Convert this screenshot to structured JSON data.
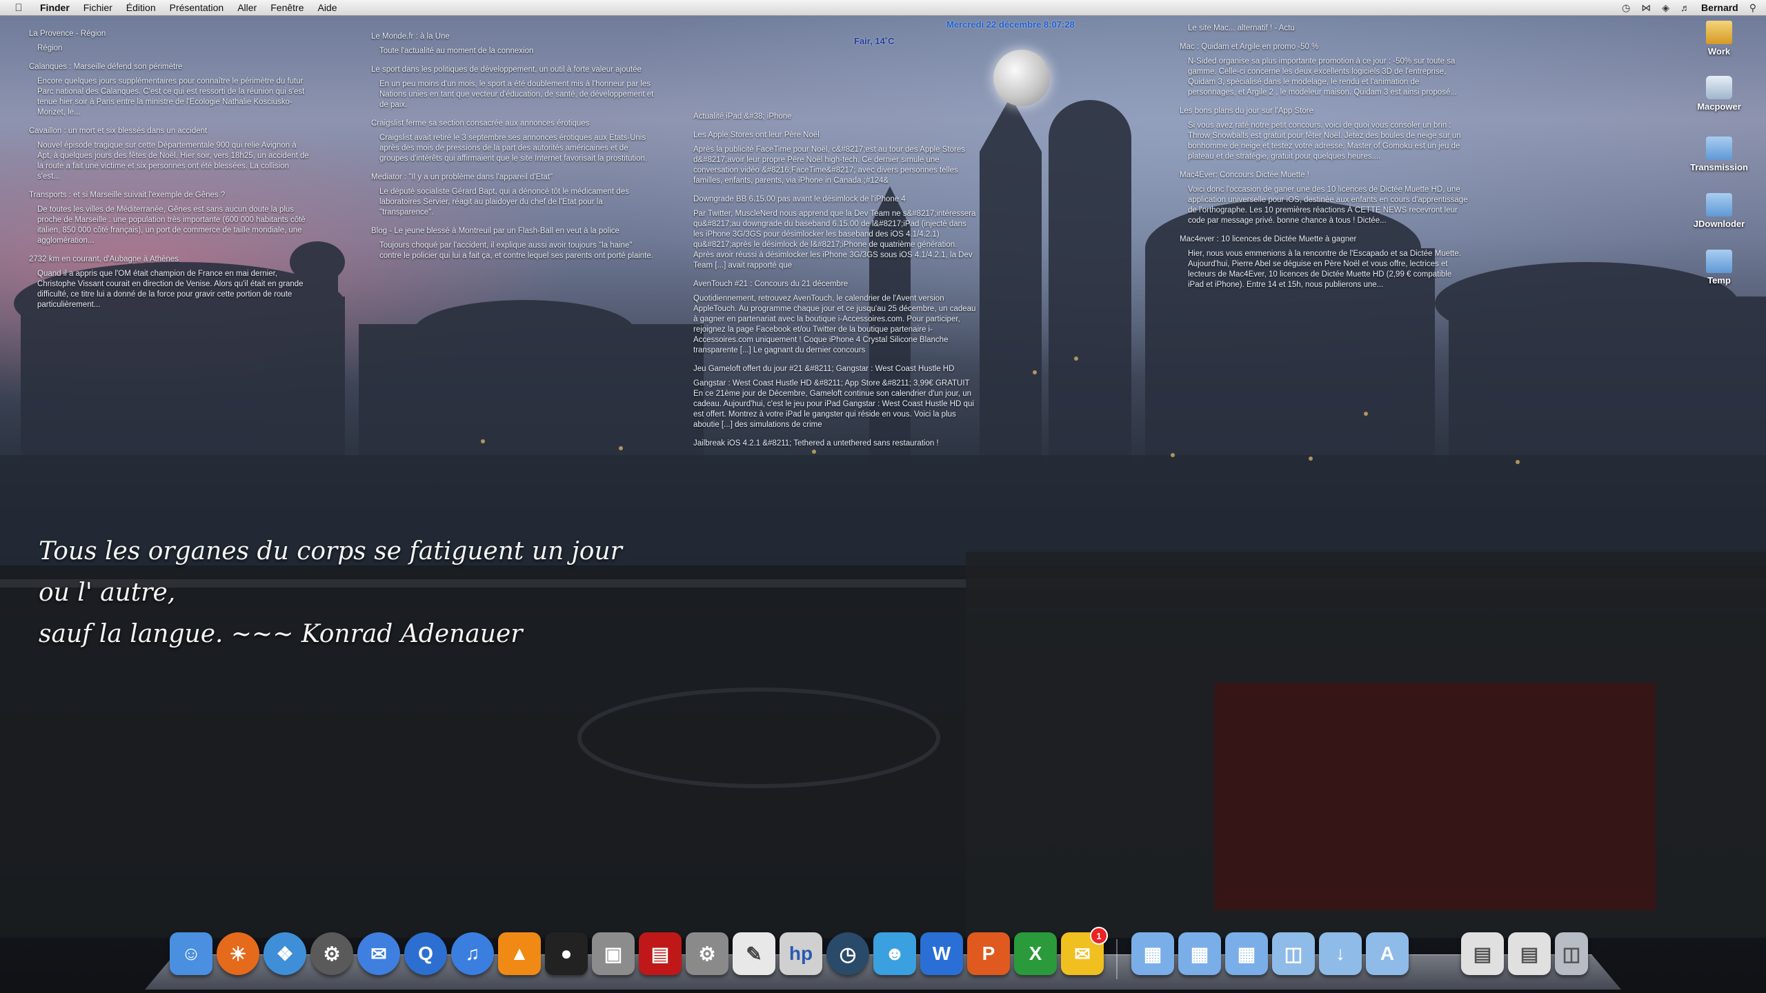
{
  "menubar": {
    "apple_icon": "apple-icon",
    "items": [
      "Finder",
      "Fichier",
      "Édition",
      "Présentation",
      "Aller",
      "Fenêtre",
      "Aide"
    ],
    "user": "Bernard",
    "status_icons": [
      "time-machine-icon",
      "bluetooth-icon",
      "wifi-icon",
      "volume-icon",
      "spotlight-icon"
    ]
  },
  "clock": {
    "text": "Mercredi 22 décembre  8:07:28"
  },
  "weather": {
    "text": "Fair, 14˚C"
  },
  "feed_col1": {
    "items": [
      {
        "title": "La Provence - Région",
        "body": "Région"
      },
      {
        "title": "Calanques : Marseille défend son périmètre",
        "body": "Encore quelques jours supplémentaires pour connaître le périmètre du futur Parc national des Calanques. C'est ce qui est ressorti de la réunion qui s'est tenue hier soir à Paris entre la ministre de l'Ecologie Nathalie Kosciusko-Morizet, le..."
      },
      {
        "title": "Cavaillon : un mort et six blessés dans un accident",
        "body": "Nouvel épisode tragique sur cette Départementale 900 qui relie Avignon à Apt, à quelques jours des fêtes de Noël.  Hier soir, vers 18h25, un accident de la route a fait une victime et six personnes ont été blessées. La collision s'est..."
      },
      {
        "title": "Transports : et si Marseille suivait l'exemple de Gênes ?",
        "body": "De toutes les villes de Méditerranée, Gênes est sans aucun doute la plus proche de Marseille : une population très importante (600 000 habitants côté italien, 850 000 côté français), un port de commerce de taille mondiale, une agglomération..."
      },
      {
        "title": "2732 km en courant, d'Aubagne à Athènes",
        "body": "Quand il a appris que l'OM était champion de France en mai dernier, Christophe Vissant courait en direction de Venise. Alors qu'il était en grande difficulté, ce titre lui a donné de la force pour gravir cette portion de route particulièrement..."
      }
    ]
  },
  "feed_col2": {
    "items": [
      {
        "title": "Le Monde.fr : à la Une",
        "body": "Toute l'actualité au moment de la connexion"
      },
      {
        "title": "Le sport dans les politiques de développement, un outil à forte valeur ajoutée",
        "body": "En un peu moins d'un mois, le sport a été doublement mis à l'honneur par les Nations unies en tant que vecteur d'éducation, de santé, de développement et de paix."
      },
      {
        "title": "Craigslist ferme sa section consacrée aux annonces érotiques",
        "body": "Craigslist avait retiré le 3 septembre ses annonces érotiques aux Etats-Unis après des mois de pressions de la part des autorités américaines et de groupes d'intérêts qui affirmaient que le site Internet favorisait la prostitution."
      },
      {
        "title": "Mediator : \"Il y a un problème dans l'appareil d'Etat\"",
        "body": "Le député socialiste Gérard Bapt, qui a dénoncé tôt le médicament des laboratoires Servier, réagit au plaidoyer du chef de l'Etat pour la \"transparence\"."
      },
      {
        "title": "Blog - Le jeune blessé à Montreuil par un Flash-Ball en veut à la police",
        "body": "Toujours choqué par l'accident, il explique aussi avoir toujours \"la haine\" contre le policier qui lui a fait ça, et contre lequel ses parents ont porté plainte."
      }
    ]
  },
  "feed_col3": {
    "items": [
      {
        "title": "Actualité iPad &#38; iPhone",
        "body": ""
      },
      {
        "title": "Les Apple Stores ont leur Père Noël",
        "body": "Après la publicité FaceTime pour Noël, c&#8217;est au tour des Apple Stores d&#8217;avoir leur propre Père Noël high-tech. Ce dernier simule une conversation vidéo &#8216;FaceTime&#8217; avec divers personnes telles familles, enfants, parents, via iPhone in Canada ;#124&"
      },
      {
        "title": "Downgrade BB 6.15.00 pas avant le désimlock de l'iPhone 4",
        "body": "Par Twitter, MuscleNerd nous apprend que la Dev Team ne s&#8217;intéressera qu&#8217;au downgrade du baseband 6.15.00 de l&#8217;iPad (injecté dans les iPhone 3G/3GS pour désimlocker les baseband des iOS 4.1/4.2.1) qu&#8217;après le désimlock de l&#8217;iPhone de quatrième génération. Après avoir réussi à désimlocker les iPhone 3G/3GS sous iOS 4.1/4.2.1, la Dev Team [...] avait rapporté que"
      },
      {
        "title": "AvenTouch #21 : Concours du 21 décembre",
        "body": "Quotidiennement, retrouvez AvenTouch, le calendrier de l'Avent version AppleTouch. Au programme chaque jour et ce jusqu'au 25 décembre, un cadeau à gagner en partenariat avec la boutique i-Accessoires.com. Pour participer, rejoignez la page Facebook et/ou Twitter de la boutique partenaire i-Accessoires.com uniquement ! Coque iPhone 4 Crystal Silicone Blanche transparente [...] Le gagnant du dernier concours"
      },
      {
        "title": "Jeu Gameloft offert du jour #21 &#8211; Gangstar : West Coast Hustle HD",
        "body": "Gangstar : West Coast Hustle HD &#8211; App Store &#8211; 3,99€ GRATUIT En ce 21ème jour de Décembre, Gameloft continue son calendrier d'un jour, un cadeau. Aujourd'hui, c'est le jeu pour iPad Gangstar : West Coast Hustle HD qui est offert. Montrez à votre iPad le gangster qui réside en vous. Voici la plus aboutie [...] des simulations de crime"
      },
      {
        "title": "Jailbreak iOS 4.2.1 &#8211; Tethered a untethered sans restauration !",
        "body": ""
      }
    ]
  },
  "feed_col4": {
    "items": [
      {
        "title": "Le site Mac... alternatif ! - Actu",
        "body": ""
      },
      {
        "title": "Mac : Quidam et Argile en promo -50 %",
        "body": "N-Sided organise sa plus importante promotion à ce jour : -50% sur toute sa gamme. Celle-ci concerne les deux excellents logiciels 3D de l'entreprise, Quidam 3, spécialisé dans le modelage, le rendu et l'animation de personnages, et Argile 2 , le modeleur maison.   Quidam 3 est ainsi proposé..."
      },
      {
        "title": "Les bons plans du jour sur l'App Store",
        "body": "Si vous avez raté notre petit concours, voici de quoi vous consoler un brin : Throw Snowballs est gratuit pour fêter Noël. Jetez des boules de neige sur un bonhomme de neige et testez votre adresse.        Master of Gomoku est un jeu de plateau et de stratégie, gratuit pour quelques heures...."
      },
      {
        "title": "Mac4Ever: Concours Dictée Muette !",
        "body": "Voici donc l'occasion de ganer une des 10 licences de Dictée Muette HD, une application universelle pour iOS, destinée aux enfants en cours d'apprentissage de l'orthographe. Les 10 premières réactions À CETTE NEWS recevront leur code par message privé. bonne chance à tous !        Dictée..."
      },
      {
        "title": "Mac4ever : 10 licences de Dictée Muette à gagner",
        "body": "Hier, nous vous emmenions à la rencontre de l'Escapado et sa Dictée Muette. Aujourd'hui, Pierre Abel se déguise en Père Noël et vous offre, lectrices et lecteurs de Mac4Ever, 10 licences de Dictée Muette HD (2,99 € compatible iPad et iPhone).   Entre 14 et 15h, nous publierons une..."
      }
    ]
  },
  "quote": {
    "line1": "Tous les organes du corps se fatiguent un jour ou l' autre,",
    "line2": "sauf la langue. ~~~ Konrad Adenauer"
  },
  "desktop_icons": [
    {
      "label": "Work",
      "icon": "work-icon"
    },
    {
      "label": "Macpower",
      "icon": "time-machine-drive-icon"
    },
    {
      "label": "Transmission",
      "icon": "folder-icon"
    },
    {
      "label": "JDownloder",
      "icon": "folder-icon"
    },
    {
      "label": "Temp",
      "icon": "folder-icon"
    }
  ],
  "dock": {
    "apps": [
      {
        "icon": "finder-icon",
        "color": "#4a8fe0"
      },
      {
        "icon": "firefox-icon",
        "color": "#e56a1c"
      },
      {
        "icon": "safari-icon",
        "color": "#3f8fd8"
      },
      {
        "icon": "steam-icon",
        "color": "#5a5a5a"
      },
      {
        "icon": "ichat-icon",
        "color": "#3f7fe0"
      },
      {
        "icon": "quicktime-icon",
        "color": "#2d6fd1"
      },
      {
        "icon": "itunes-icon",
        "color": "#3a7fe0"
      },
      {
        "icon": "vlc-icon",
        "color": "#f08a14"
      },
      {
        "icon": "remote-icon",
        "color": "#222222"
      },
      {
        "icon": "preview-icon",
        "color": "#8c8c8c"
      },
      {
        "icon": "photo-booth-icon",
        "color": "#c01818"
      },
      {
        "icon": "system-preferences-icon",
        "color": "#8a8a8a"
      },
      {
        "icon": "textedit-icon",
        "color": "#e8e8e8"
      },
      {
        "icon": "hp-printer-icon",
        "color": "#d0d0d0"
      },
      {
        "icon": "time-machine-icon",
        "color": "#2a4a6a"
      },
      {
        "icon": "msn-messenger-icon",
        "color": "#3aa0e0"
      },
      {
        "icon": "word-icon",
        "color": "#2a6fd6"
      },
      {
        "icon": "powerpoint-icon",
        "color": "#e05a20"
      },
      {
        "icon": "excel-icon",
        "color": "#2a9a3a"
      },
      {
        "icon": "mail-icon",
        "color": "#f0c020"
      }
    ],
    "mail_badge": "1",
    "stacks": [
      {
        "icon": "applications-stack-icon",
        "color": "#7aaee8"
      },
      {
        "icon": "applications-stack-icon",
        "color": "#7aaee8"
      },
      {
        "icon": "applications-stack-icon",
        "color": "#7aaee8"
      },
      {
        "icon": "documents-folder-icon",
        "color": "#8fbbe8"
      },
      {
        "icon": "downloads-folder-icon",
        "color": "#8fbbe8"
      },
      {
        "icon": "applications-folder-icon",
        "color": "#8fbbe8"
      },
      {
        "icon": "minimized-window-icon",
        "color": "#e0e0e0"
      },
      {
        "icon": "minimized-window-icon",
        "color": "#e0e0e0"
      },
      {
        "icon": "trash-icon",
        "color": "#b8bcc4"
      }
    ]
  }
}
